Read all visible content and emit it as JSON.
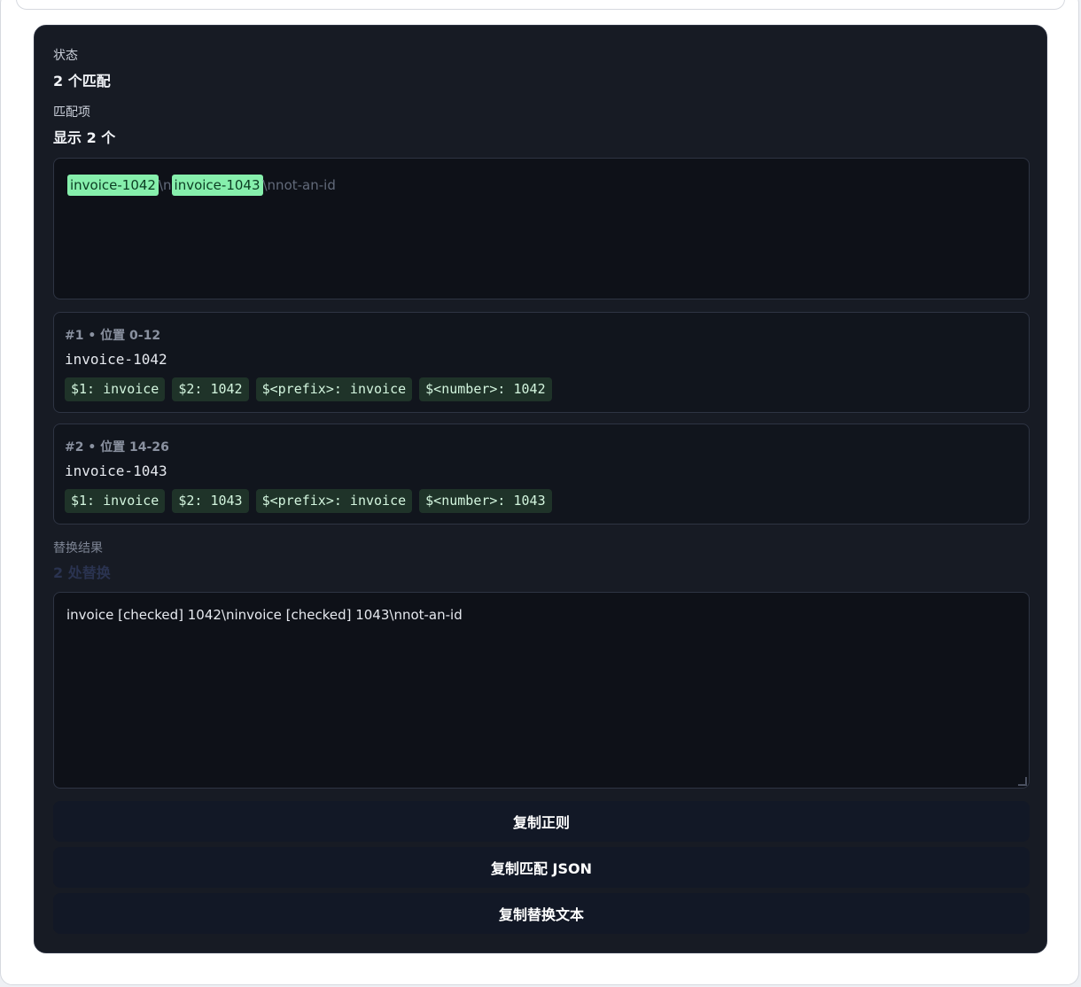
{
  "status": {
    "label": "状态",
    "value": "2 个匹配"
  },
  "matches_section": {
    "label": "匹配项",
    "value": "显示 2 个"
  },
  "preview": {
    "match1": "invoice-1042",
    "sep1": "\\n",
    "match2": "invoice-1043",
    "rest": "\\nnot-an-id"
  },
  "matches": [
    {
      "header": "#1 • 位置 0-12",
      "text": "invoice-1042",
      "groups": [
        "$1: invoice",
        "$2: 1042",
        "$<prefix>: invoice",
        "$<number>: 1042"
      ]
    },
    {
      "header": "#2 • 位置 14-26",
      "text": "invoice-1043",
      "groups": [
        "$1: invoice",
        "$2: 1043",
        "$<prefix>: invoice",
        "$<number>: 1043"
      ]
    }
  ],
  "replace_section": {
    "label": "替换结果",
    "value": "2 处替换"
  },
  "replace_result": "invoice [checked] 1042\\ninvoice [checked] 1043\\nnot-an-id",
  "buttons": {
    "copy_regex": "复制正则",
    "copy_json": "复制匹配 JSON",
    "copy_replace": "复制替换文本"
  }
}
